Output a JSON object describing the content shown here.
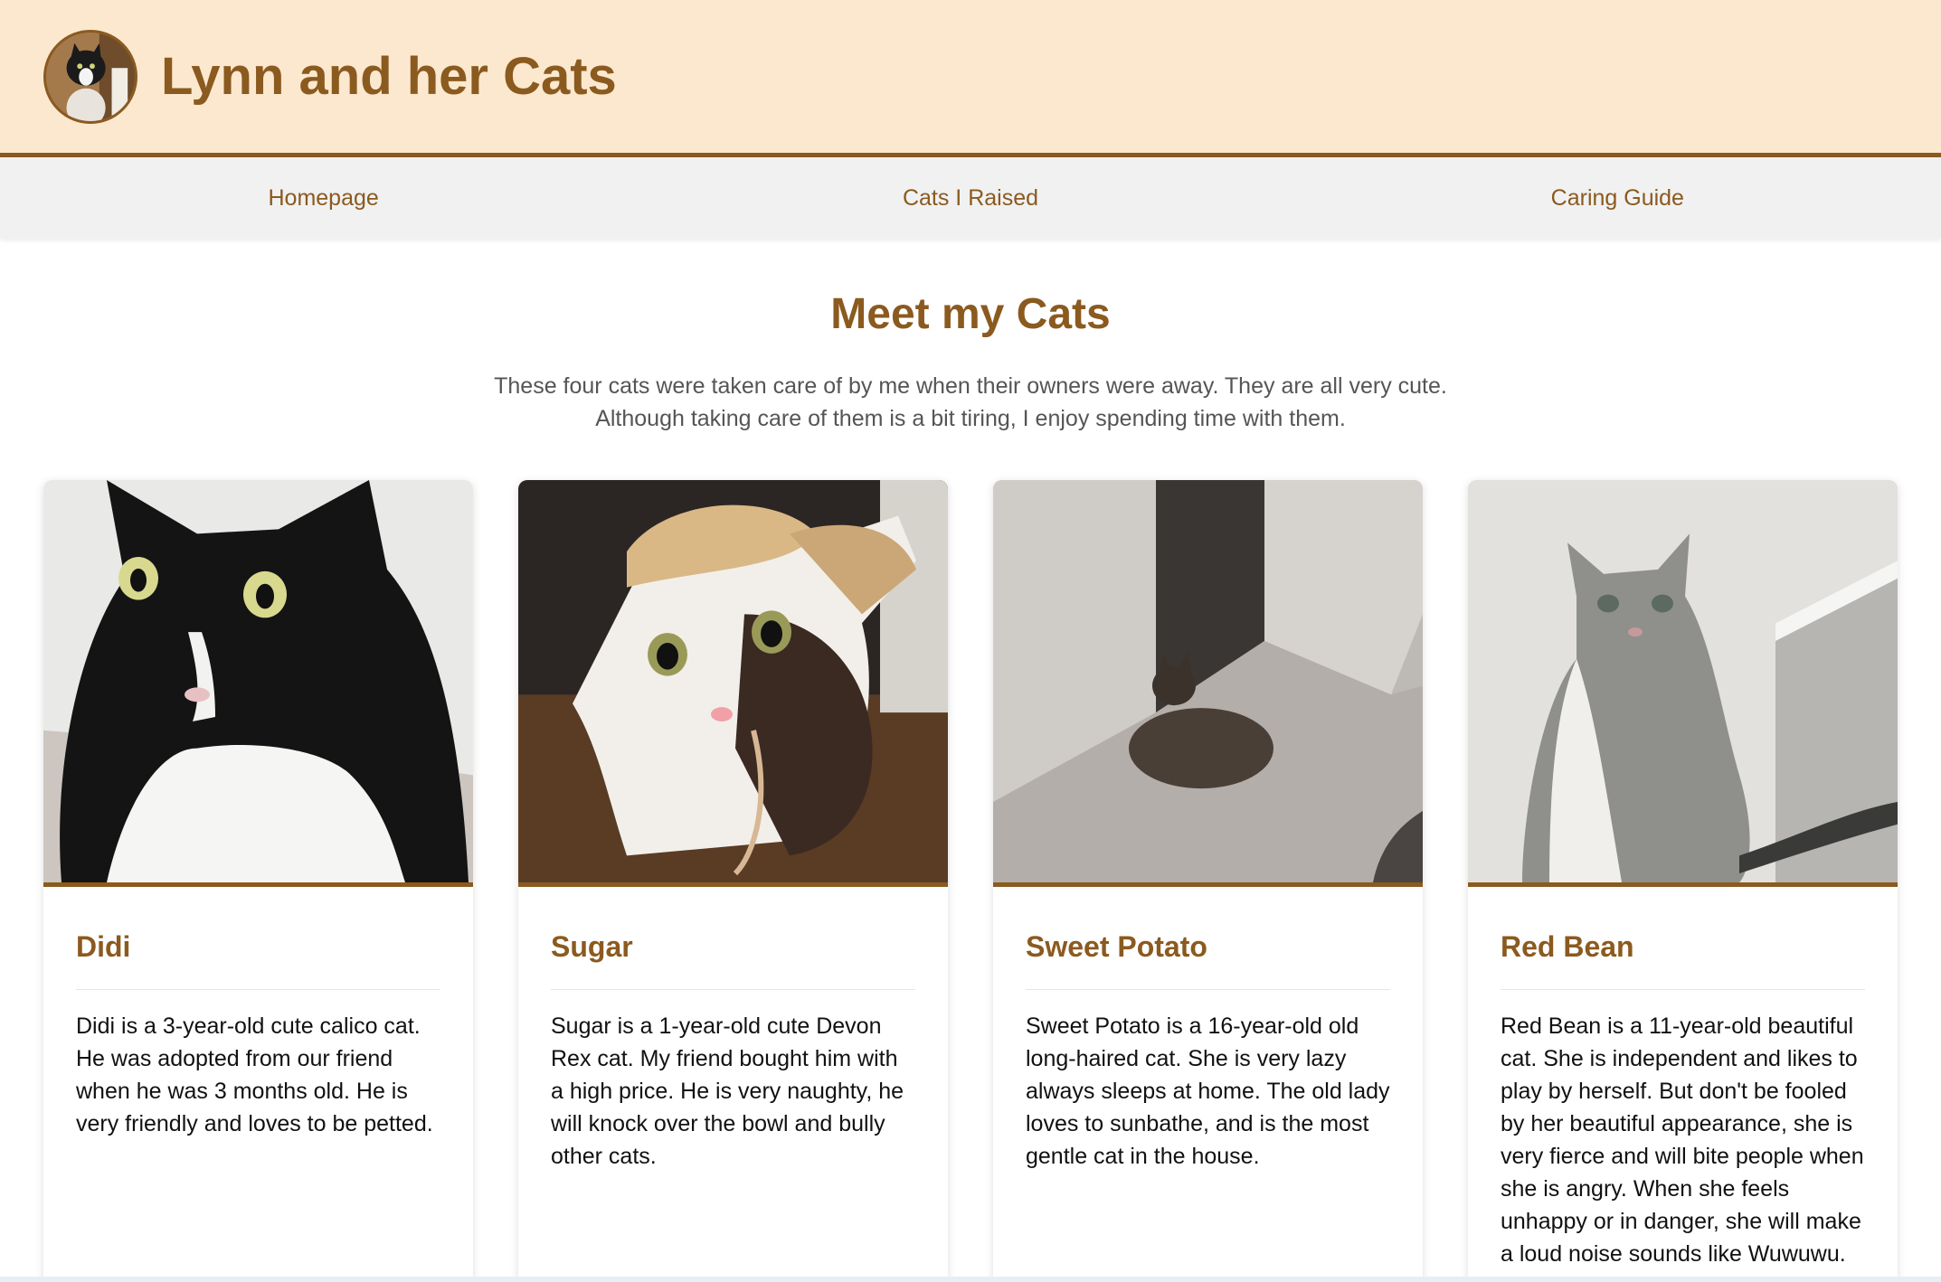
{
  "site": {
    "title": "Lynn and her Cats",
    "accent_color": "#8b5a1f",
    "header_bg": "#fbe8cf"
  },
  "nav": {
    "items": [
      {
        "label": "Homepage"
      },
      {
        "label": "Cats I Raised"
      },
      {
        "label": "Caring Guide"
      }
    ]
  },
  "intro": {
    "heading": "Meet my Cats",
    "text": "These four cats were taken care of by me when their owners were away. They are all very cute. Although taking care of them is a bit tiring, I enjoy spending time with them."
  },
  "cats": [
    {
      "name": "Didi",
      "photo_icon": "tuxedo-cat-photo",
      "description": "Didi is a 3-year-old cute calico cat. He was adopted from our friend when he was 3 months old. He is very friendly and loves to be petted."
    },
    {
      "name": "Sugar",
      "photo_icon": "cat-in-hat-photo",
      "description": "Sugar is a 1-year-old cute Devon Rex cat. My friend bought him with a high price. He is very naughty, he will knock over the bowl and bully other cats."
    },
    {
      "name": "Sweet Potato",
      "photo_icon": "cat-on-carpet-photo",
      "description": "Sweet Potato is a 16-year-old old long-haired cat. She is very lazy always sleeps at home. The old lady loves to sunbathe, and is the most gentle cat in the house."
    },
    {
      "name": "Red Bean",
      "photo_icon": "tabby-cat-photo",
      "description": "Red Bean is a 11-year-old beautiful cat. She is independent and likes to play by herself. But don't be fooled by her beautiful appearance, she is very fierce and will bite people when she is angry. When she feels unhappy or in danger, she will make a loud noise sounds like Wuwuwu."
    }
  ]
}
